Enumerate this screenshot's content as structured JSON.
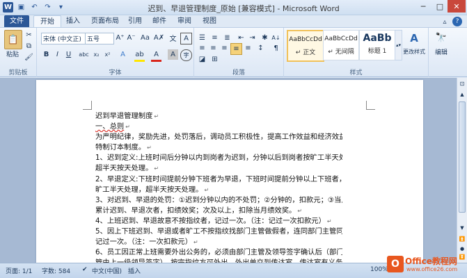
{
  "title": "迟到、早退管理制度_原始 [兼容模式] - Microsoft Word",
  "tabs": {
    "file": "文件",
    "home": "开始",
    "insert": "插入",
    "layout": "页面布局",
    "references": "引用",
    "mailings": "邮件",
    "review": "审阅",
    "view": "视图"
  },
  "ribbon": {
    "clipboard": {
      "paste": "粘贴",
      "label": "剪贴板"
    },
    "font": {
      "name": "宋体 (中文正)",
      "size": "五号",
      "label": "字体"
    },
    "paragraph": {
      "label": "段落"
    },
    "styles": {
      "label": "样式",
      "items": [
        {
          "preview": "AaBbCcDd",
          "name": "↵ 正文"
        },
        {
          "preview": "AaBbCcDd",
          "name": "↵ 无间隔"
        },
        {
          "preview": "AaBb",
          "name": "标题 1"
        }
      ],
      "change": "更改样式"
    },
    "editing": {
      "label": "编辑"
    }
  },
  "document": {
    "lines": [
      "迟到早退管理制度",
      "一、总则",
      "为严明纪律，奖励先进，处罚落后，调动员工积极性，提高工作效益和经济效益，",
      "特制订本制度。",
      "1、迟到定义:上班时间后分钟以内到岗者为迟到，分钟以后到岗者按旷工半天处理，",
      "超半天按天处理。",
      "2、早退定义:下班时间提前分钟下班者为早退，下班时间提前分钟以上下班者，按",
      "旷工半天处理，超半天按天处理。",
      "3、对迟到、早退的处罚：①迟到分钟以内的不处罚；②分钟的，扣款元；③当月",
      "累计迟到、早退次者，扣绩效奖；次及以上，扣除当月绩效奖。",
      "4、上班迟到、早退故意不按指纹者，记过一次。（注：记过一次扣款元）",
      "5、因上下班迟到、早退或者旷工不按指纹找部门主管做假者，连同部门主管同时",
      "记过一次。（注：一次扣款元）",
      "6、员工因正常上班需要外出公务的，必须由部门主管及领导签字确认后（部门主",
      "管由上一级领导签字），按完指纹方可外出，外出单交到传达室。传达室有义务提"
    ]
  },
  "status": {
    "page": "页面: 1/1",
    "words": "字数: 584",
    "lang": "中文(中国)",
    "insert": "插入",
    "zoom": "100%"
  },
  "watermark": {
    "text1": "Office教程网",
    "text2": "www.office26.com"
  }
}
